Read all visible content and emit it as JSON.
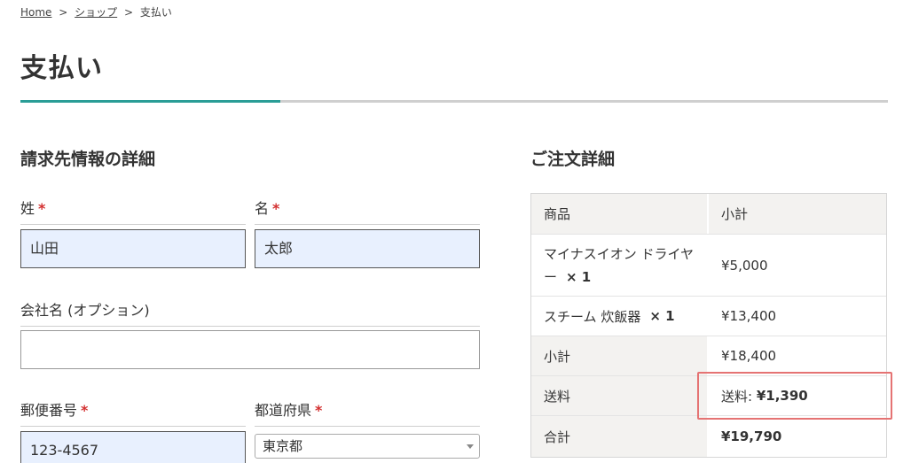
{
  "breadcrumb": {
    "home": "Home",
    "sep": ">",
    "shop": "ショップ",
    "current": "支払い"
  },
  "page_title": "支払い",
  "billing": {
    "heading": "請求先情報の詳細",
    "required_mark": "*",
    "last_name": {
      "label": "姓",
      "value": "山田"
    },
    "first_name": {
      "label": "名",
      "value": "太郎"
    },
    "company": {
      "label": "会社名 (オプション)",
      "value": ""
    },
    "postcode": {
      "label": "郵便番号",
      "value": "123-4567"
    },
    "prefecture": {
      "label": "都道府県",
      "value": "東京都"
    }
  },
  "order": {
    "heading": "ご注文詳細",
    "col_product": "商品",
    "col_subtotal": "小計",
    "items": [
      {
        "name": "マイナスイオン ドライヤー",
        "qty": "× 1",
        "price": "¥5,000"
      },
      {
        "name": "スチーム 炊飯器",
        "qty": "× 1",
        "price": "¥13,400"
      }
    ],
    "subtotal_label": "小計",
    "subtotal_value": "¥18,400",
    "shipping_label": "送料",
    "shipping_method": "送料:",
    "shipping_value": "¥1,390",
    "total_label": "合計",
    "total_value": "¥19,790"
  },
  "colors": {
    "accent": "#2a9d96",
    "required": "#d32f2f",
    "autofill": "#e8f0fe",
    "highlight": "#e57373"
  }
}
